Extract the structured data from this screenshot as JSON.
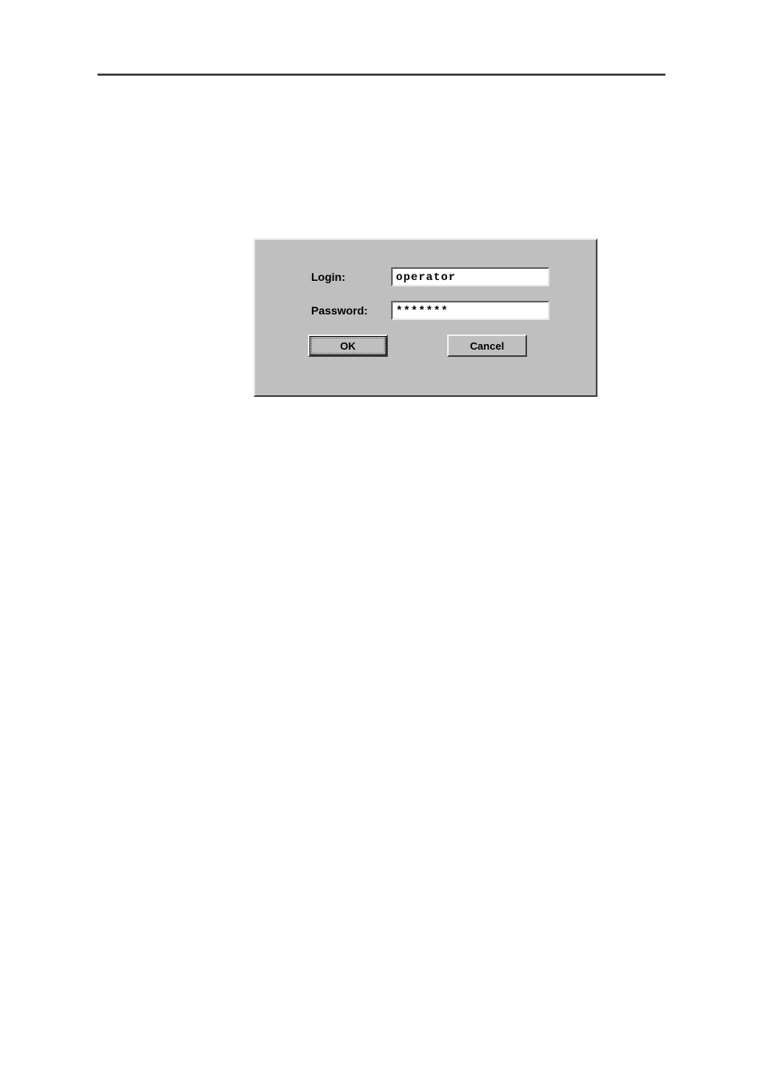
{
  "dialog": {
    "login_label": "Login:",
    "password_label": "Password:",
    "login_value": "operator",
    "password_value": "*******",
    "ok_label": "OK",
    "cancel_label": "Cancel"
  }
}
